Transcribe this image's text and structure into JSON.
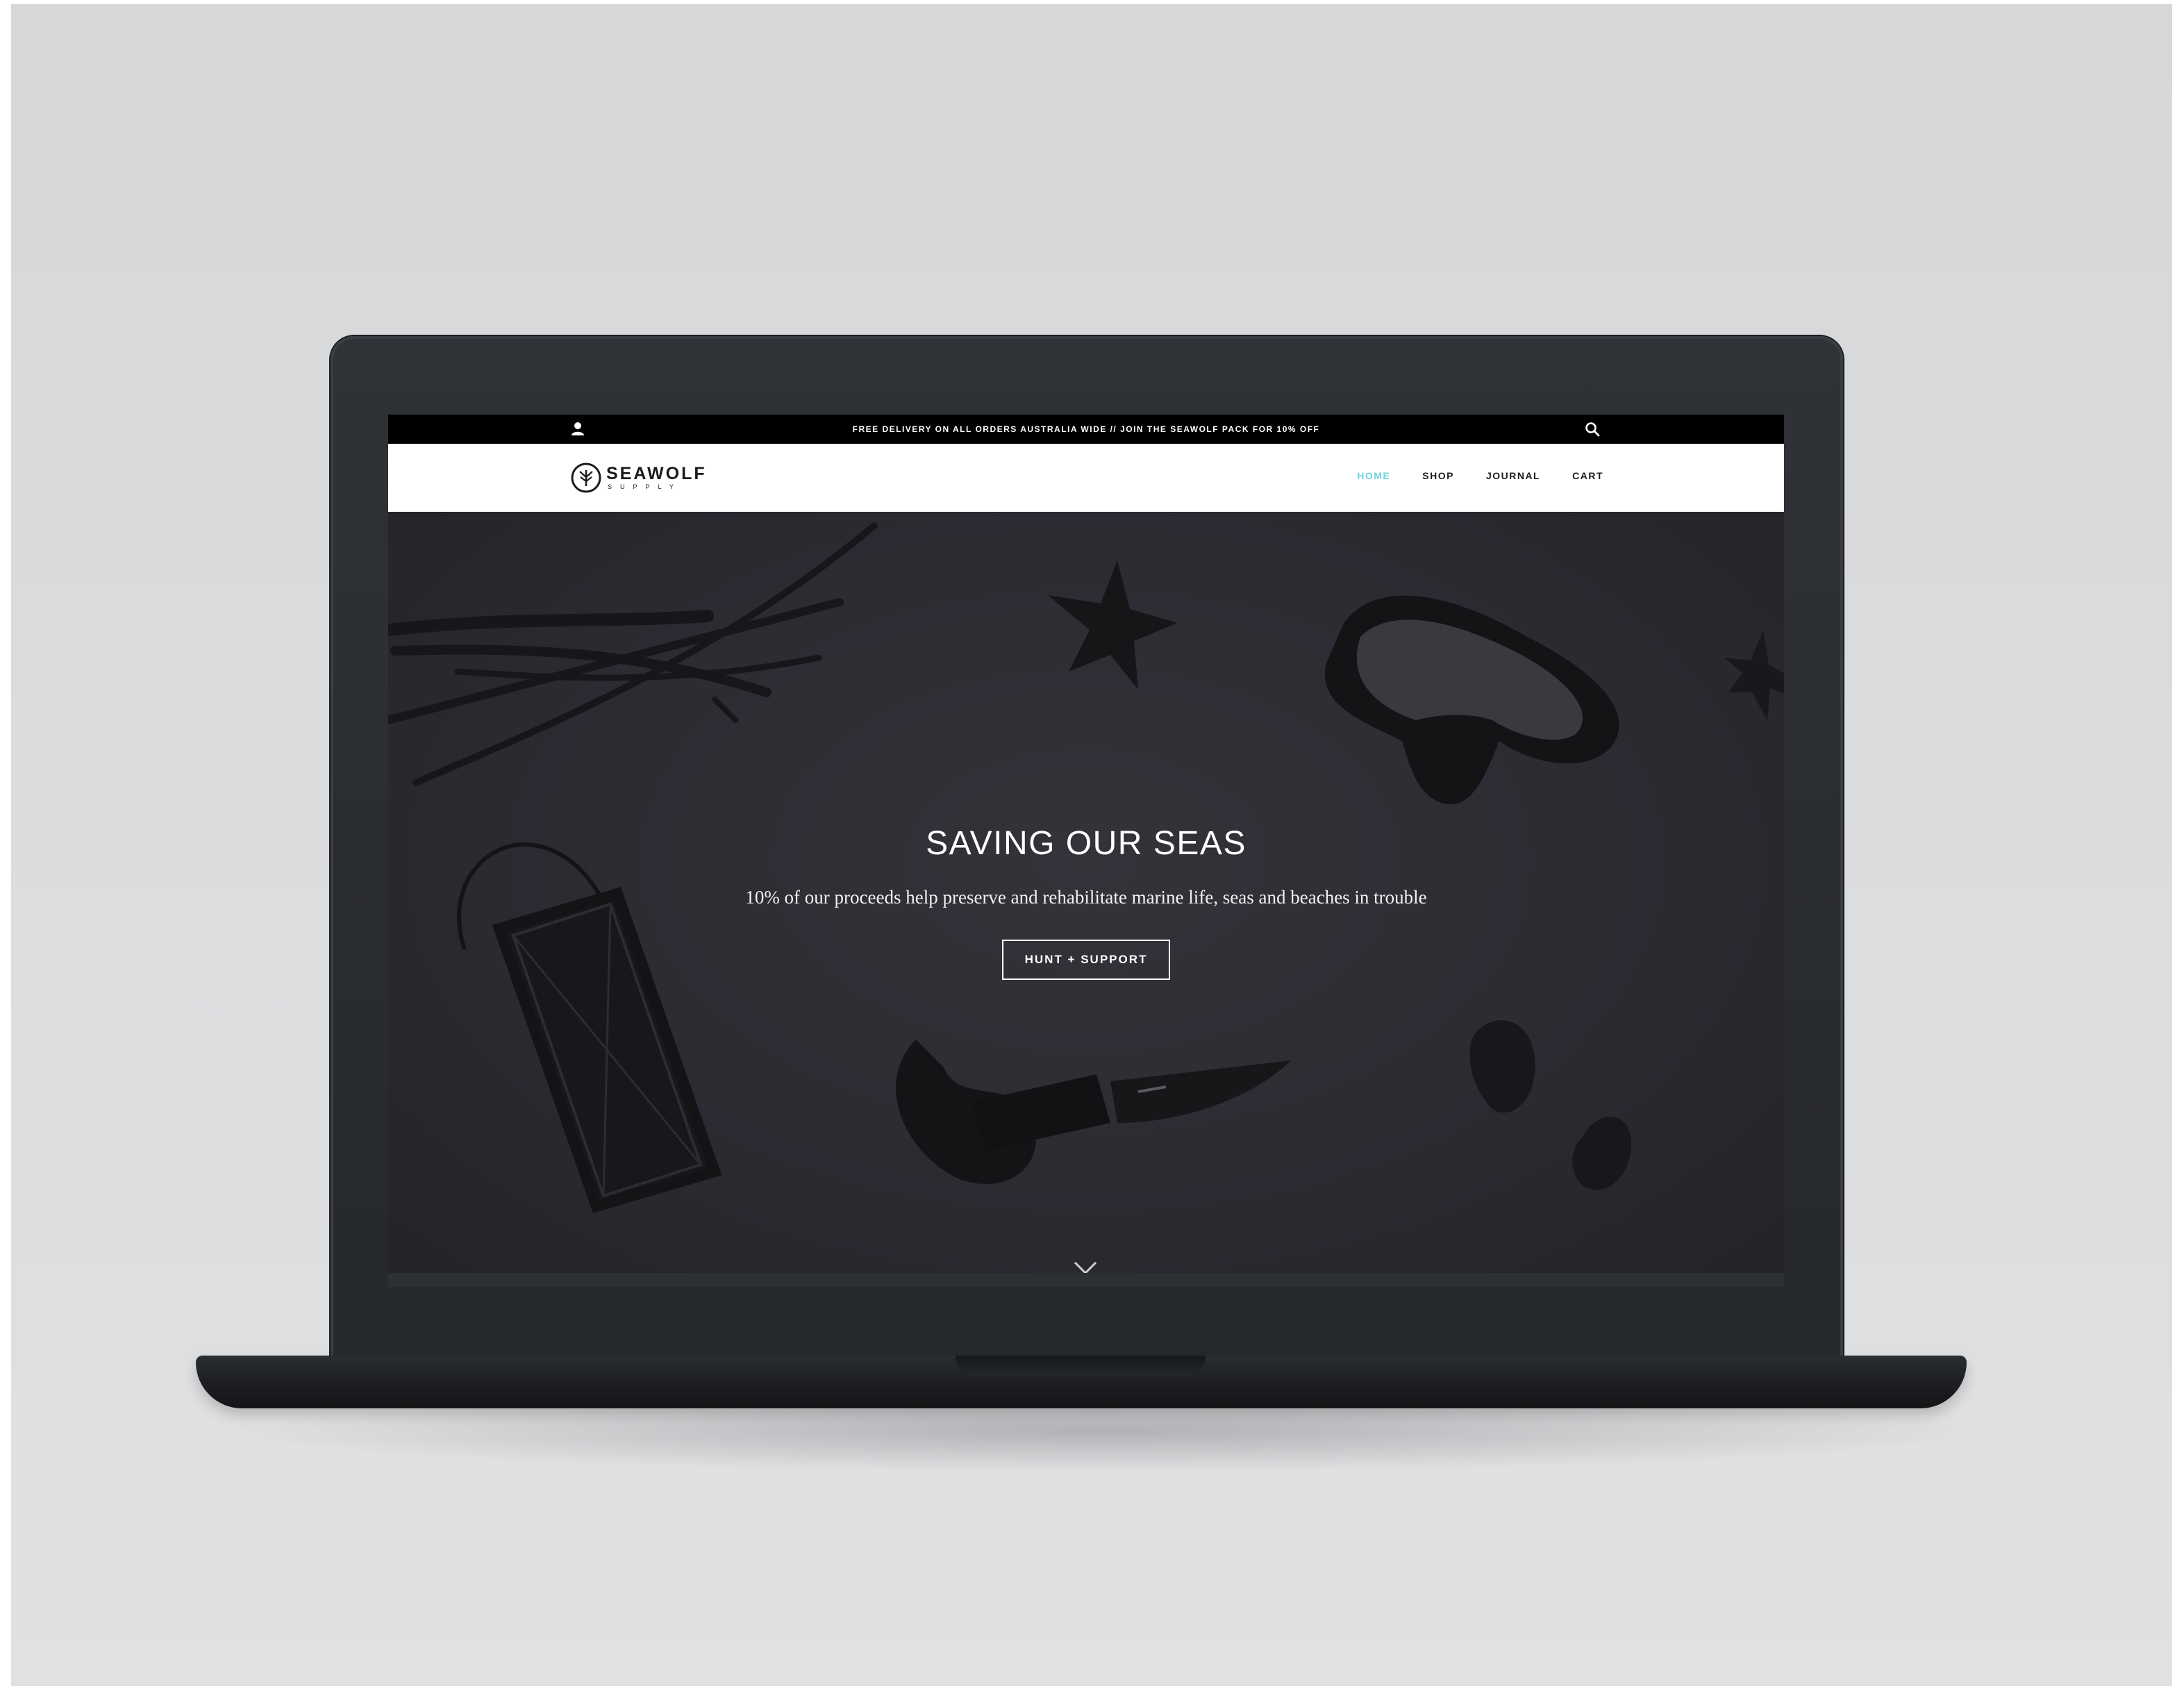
{
  "topbar": {
    "promo": "FREE DELIVERY ON ALL ORDERS AUSTRALIA WIDE // JOIN THE SEAWOLF PACK FOR 10% OFF",
    "icons": [
      "user-icon",
      "search-icon"
    ]
  },
  "brand": {
    "name": "SEAWOLF",
    "subname": "SUPPLY"
  },
  "nav": {
    "items": [
      {
        "label": "HOME",
        "active": true
      },
      {
        "label": "SHOP",
        "active": false
      },
      {
        "label": "JOURNAL",
        "active": false
      },
      {
        "label": "CART",
        "active": false
      }
    ]
  },
  "hero": {
    "title": "SAVING OUR SEAS",
    "subtitle": "10% of our proceeds help preserve and rehabilitate marine life, seas and beaches in trouble",
    "cta": "HUNT + SUPPORT"
  },
  "colors": {
    "accent": "#6ed4df",
    "hero_bg": "#2b2a31",
    "topbar_bg": "#000000",
    "navbar_bg": "#ffffff"
  }
}
